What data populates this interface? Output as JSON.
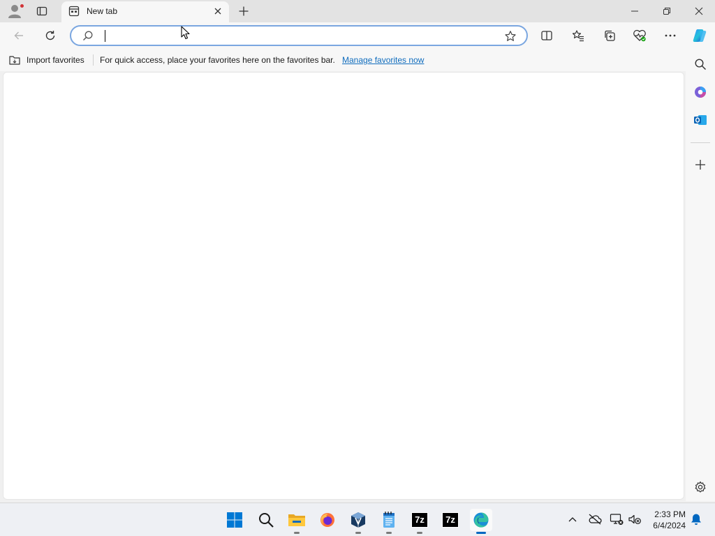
{
  "tab": {
    "title": "New tab",
    "close_label": "Close tab"
  },
  "new_tab_label": "New tab",
  "window_controls": {
    "minimize": "Minimize",
    "restore": "Restore",
    "close": "Close"
  },
  "toolbar": {
    "back": "Back",
    "refresh": "Refresh",
    "split_screen": "Split screen",
    "favorites": "Favorites",
    "collections": "Collections",
    "browser_essentials": "Browser essentials",
    "more": "Settings and more",
    "copilot": "Copilot"
  },
  "address_bar": {
    "value": "",
    "placeholder": "",
    "add_favorite": "Add this page to favorites"
  },
  "favorites_bar": {
    "import_label": "Import favorites",
    "message": "For quick access, place your favorites here on the favorites bar.",
    "manage_link": "Manage favorites now"
  },
  "sidebar": {
    "search": "Search",
    "copilot_app": "Microsoft 365",
    "outlook": "Outlook",
    "add": "Customize",
    "settings": "Settings"
  },
  "taskbar": {
    "apps": [
      {
        "name": "start-button",
        "label": "Start"
      },
      {
        "name": "search-button",
        "label": "Search"
      },
      {
        "name": "file-explorer",
        "label": "File Explorer"
      },
      {
        "name": "firefox",
        "label": "Firefox"
      },
      {
        "name": "virtualbox",
        "label": "VirtualBox"
      },
      {
        "name": "notepad",
        "label": "Notepad"
      },
      {
        "name": "7zip-1",
        "label": "7-Zip"
      },
      {
        "name": "7zip-2",
        "label": "7-Zip"
      },
      {
        "name": "edge",
        "label": "Microsoft Edge"
      }
    ],
    "sevenz_text": "7z",
    "time": "2:33 PM",
    "date": "6/4/2024"
  },
  "colors": {
    "accent": "#0067c0",
    "link": "#0f6cbd",
    "notification_dot": "#d13438"
  }
}
